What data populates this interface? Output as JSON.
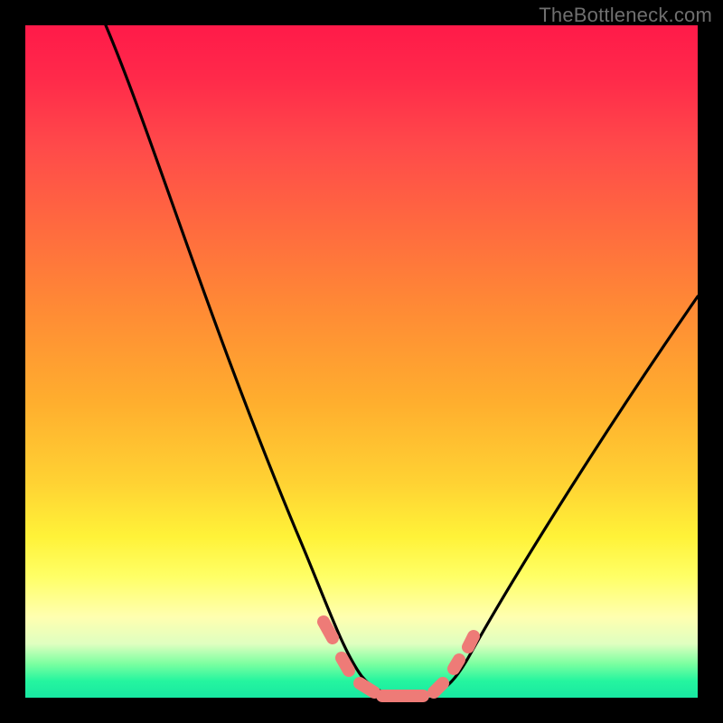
{
  "watermark": "TheBottleneck.com",
  "chart_data": {
    "type": "line",
    "title": "",
    "xlabel": "",
    "ylabel": "",
    "xlim": [
      0,
      100
    ],
    "ylim": [
      0,
      100
    ],
    "grid": false,
    "legend": false,
    "series": [
      {
        "name": "curve",
        "color": "#000000",
        "x": [
          12,
          16,
          20,
          24,
          28,
          32,
          36,
          40,
          44,
          46,
          48,
          50,
          52,
          54,
          56,
          58,
          60,
          62,
          66,
          70,
          74,
          78,
          82,
          86,
          90,
          94,
          98,
          100
        ],
        "y": [
          100,
          92,
          83,
          74,
          64,
          53,
          42,
          31,
          20,
          14,
          9,
          5,
          2,
          1,
          0,
          0,
          0,
          1,
          4,
          9,
          15,
          22,
          29,
          36,
          43,
          50,
          57,
          60
        ]
      },
      {
        "name": "highlight-band",
        "color": "#ee7b77",
        "x": [
          44,
          46,
          48,
          50,
          52,
          54,
          56,
          58,
          60,
          62,
          64
        ],
        "y": [
          11,
          7,
          4,
          2,
          1,
          0.5,
          0.5,
          0.5,
          1,
          3,
          6
        ]
      }
    ],
    "background_gradient": {
      "top": "#ff1a49",
      "upper_mid": "#ffae2e",
      "mid": "#fff238",
      "lower_mid": "#ffffb0",
      "bottom": "#18e8a2"
    }
  }
}
